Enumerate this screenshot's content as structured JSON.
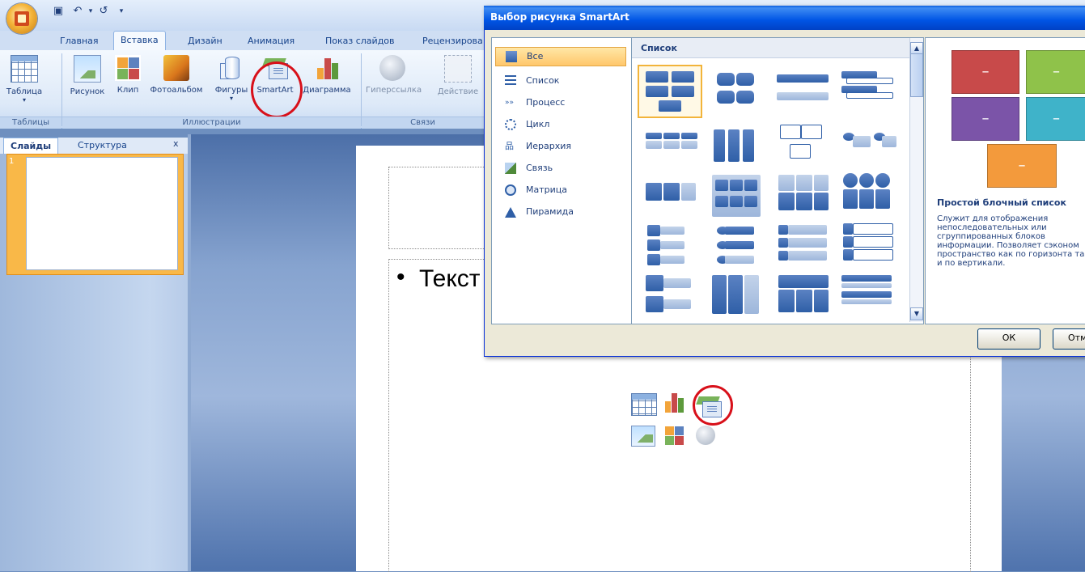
{
  "ribbon": {
    "quick_access": [
      "save-icon",
      "undo-icon",
      "redo-icon",
      "customize-icon"
    ],
    "tabs": [
      "Главная",
      "Вставка",
      "Дизайн",
      "Анимация",
      "Показ слайдов",
      "Рецензирова"
    ],
    "active_tab": "Вставка",
    "buttons": {
      "table": "Таблица",
      "picture": "Рисунок",
      "clip": "Клип",
      "album": "Фотоальбом",
      "shapes": "Фигуры",
      "smartart": "SmartArt",
      "chart": "Диаграмма",
      "hyperlink": "Гиперссылка",
      "action": "Действие"
    },
    "groups": {
      "tables": "Таблицы",
      "illustrations": "Иллюстрации",
      "links": "Связи"
    }
  },
  "slides_pane": {
    "tabs": [
      "Слайды",
      "Структура"
    ],
    "close": "x",
    "slide_number": "1"
  },
  "slide": {
    "bullet_text": "Текст",
    "bullet_char": "•"
  },
  "dialog": {
    "title": "Выбор рисунка SmartArt",
    "categories": [
      {
        "label": "Все",
        "icon": "all-icon"
      },
      {
        "label": "Список",
        "icon": "list-icon"
      },
      {
        "label": "Процесс",
        "icon": "process-icon"
      },
      {
        "label": "Цикл",
        "icon": "cycle-icon"
      },
      {
        "label": "Иерархия",
        "icon": "hierarchy-icon"
      },
      {
        "label": "Связь",
        "icon": "relationship-icon"
      },
      {
        "label": "Матрица",
        "icon": "matrix-icon"
      },
      {
        "label": "Пирамида",
        "icon": "pyramid-icon"
      }
    ],
    "selected_category": "Все",
    "gallery_header": "Список",
    "preview": {
      "boxes": [
        "–",
        "–",
        "–",
        "–",
        "–"
      ],
      "colors": [
        "#c84a4a",
        "#8fc24a",
        "#7b54a8",
        "#3fb3c9",
        "#f39a3c"
      ],
      "title": "Простой блочный список",
      "description": "Служит для отображения непоследовательных или сгруппированных блоков информации. Позволяет сэконом пространство как по горизонта так и по вертикали."
    },
    "ok_label": "ОК",
    "cancel_label": "Отм"
  },
  "highlight_color": "#d8101a"
}
